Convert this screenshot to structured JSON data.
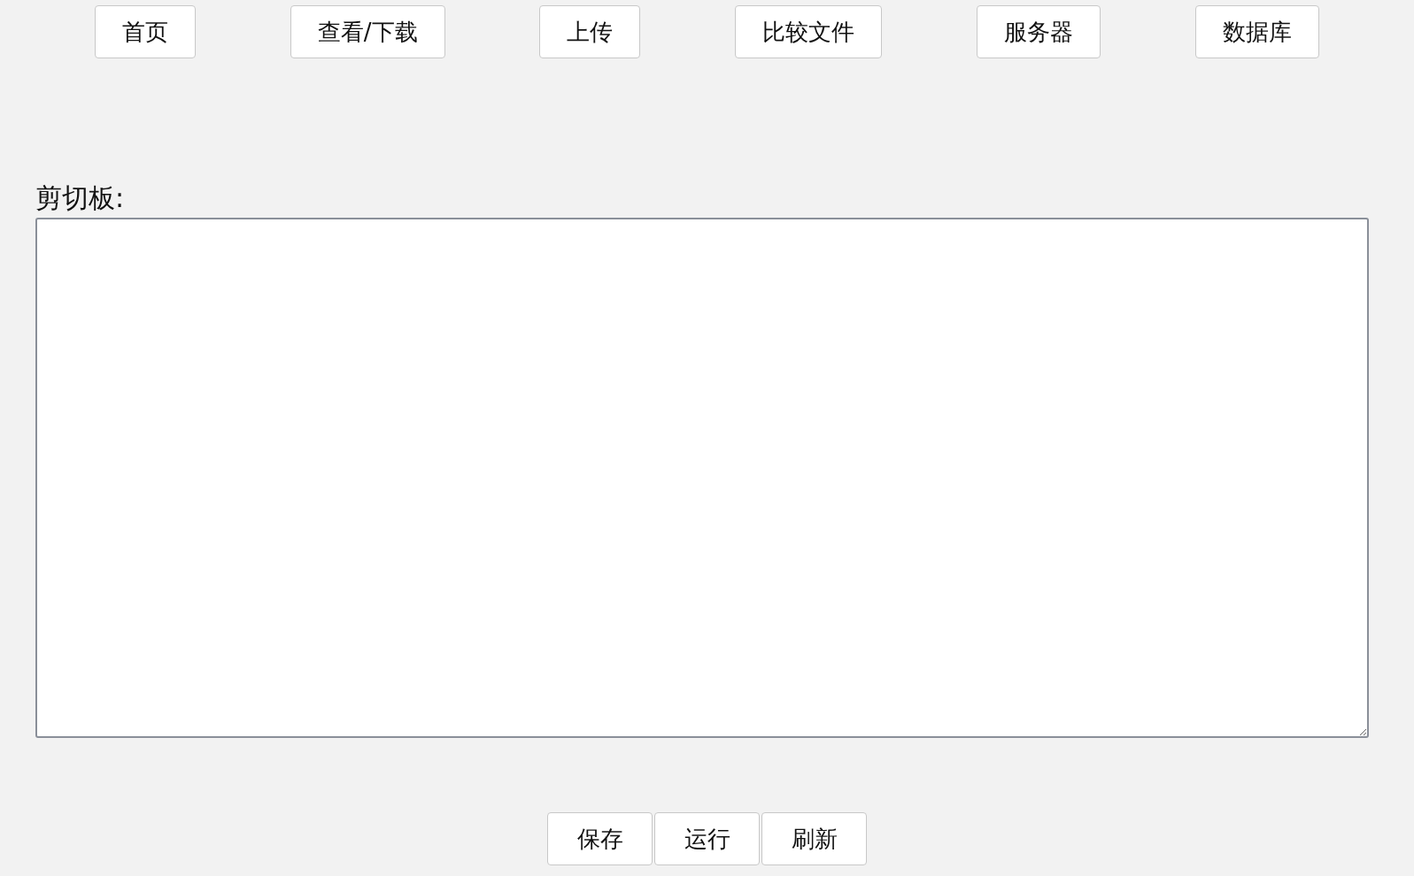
{
  "nav": [
    {
      "label": "首页"
    },
    {
      "label": "查看/下载"
    },
    {
      "label": "上传"
    },
    {
      "label": "比较文件"
    },
    {
      "label": "服务器"
    },
    {
      "label": "数据库"
    }
  ],
  "clipboard": {
    "label": "剪切板:"
  },
  "actions": [
    {
      "label": "保存"
    },
    {
      "label": "运行"
    },
    {
      "label": "刷新"
    }
  ]
}
